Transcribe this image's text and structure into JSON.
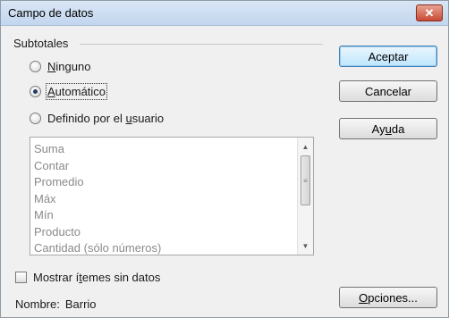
{
  "window": {
    "title": "Campo de datos",
    "close_glyph": "✕"
  },
  "subtotals": {
    "group_label": "Subtotales",
    "options": [
      {
        "pre": "",
        "accel": "N",
        "post": "inguno",
        "checked": false
      },
      {
        "pre": "",
        "accel": "A",
        "post": "utomático",
        "checked": true
      },
      {
        "pre": "Definido por el ",
        "accel": "u",
        "post": "suario",
        "checked": false
      }
    ],
    "functions": [
      "Suma",
      "Contar",
      "Promedio",
      "Máx",
      "Mín",
      "Producto",
      "Cantidad (sólo números)"
    ]
  },
  "show_empty": {
    "pre": "Mostrar í",
    "accel": "t",
    "post": "emes sin datos",
    "checked": false
  },
  "name": {
    "label": "Nombre:",
    "value": "Barrio"
  },
  "buttons": {
    "ok": "Aceptar",
    "cancel": "Cancelar",
    "help": {
      "pre": "Ay",
      "accel": "u",
      "post": "da"
    },
    "options": {
      "pre": "",
      "accel": "O",
      "post": "pciones..."
    }
  },
  "icons": {
    "close": "close-icon",
    "scroll_up": "scroll-up-icon",
    "scroll_down": "scroll-down-icon",
    "grip": "scroll-grip-icon"
  },
  "colors": {
    "default_button_border": "#3c7fb1",
    "radio_dot": "#1f3d6b",
    "list_text": "#8a8a8a"
  }
}
